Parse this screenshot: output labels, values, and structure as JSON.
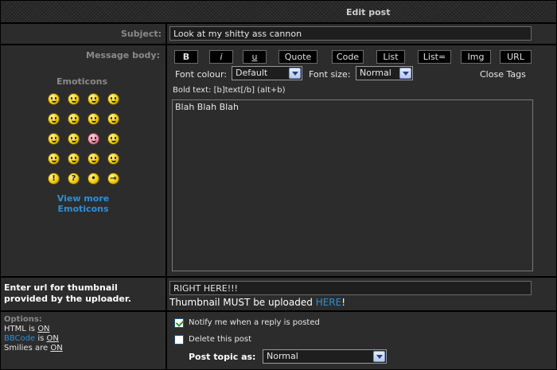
{
  "header": {
    "title": "Edit post"
  },
  "subject": {
    "label": "Subject:",
    "value": "Look at my shitty ass cannon"
  },
  "message": {
    "label": "Message body:",
    "body": "Blah Blah Blah",
    "hint": "Bold text: [b]text[/b]  (alt+b)"
  },
  "emoticons": {
    "title": "Emoticons",
    "view_more_line1": "View more",
    "view_more_line2": "Emoticons",
    "icons": [
      "very-happy-icon",
      "smile-icon",
      "sad-icon",
      "surprised-icon",
      "shocked-icon",
      "confused-icon",
      "cool-icon",
      "laughing-icon",
      "mad-icon",
      "razz-icon",
      "embarrassed-icon",
      "wink-icon",
      "evil-icon",
      "twisted-evil-icon",
      "rolling-eyes-icon",
      "wink-smile-icon",
      "exclamation-icon",
      "question-icon",
      "idea-icon",
      "arrow-icon"
    ]
  },
  "toolbar": {
    "bold": "B",
    "italic": "i",
    "underline": "u",
    "quote": "Quote",
    "code": "Code",
    "list": "List",
    "list_eq": "List=",
    "img": "Img",
    "url": "URL",
    "font_colour_label": "Font colour:",
    "font_colour_value": "Default",
    "font_size_label": "Font size:",
    "font_size_value": "Normal",
    "close_tags": "Close Tags"
  },
  "thumbnail": {
    "label_line1": "Enter url for thumbnail",
    "label_line2": "provided by the uploader.",
    "value": "RIGHT HERE!!!",
    "note_prefix": "Thumbnail MUST be uploaded ",
    "note_link": "HERE",
    "note_suffix": "!"
  },
  "options": {
    "title": "Options:",
    "html_label": "HTML is ",
    "html_state": "ON",
    "bbcode_label": "BBCode",
    "bbcode_mid": " is ",
    "bbcode_state": "ON",
    "smilies_label": "Smilies are ",
    "smilies_state": "ON",
    "notify": "Notify me when a reply is posted",
    "notify_checked": true,
    "delete": "Delete this post",
    "delete_checked": false,
    "post_topic_label": "Post topic as:",
    "post_topic_value": "Normal"
  },
  "colors": {
    "link": "#2e8fd6",
    "background": "#2c2c2c",
    "border": "#000000"
  }
}
